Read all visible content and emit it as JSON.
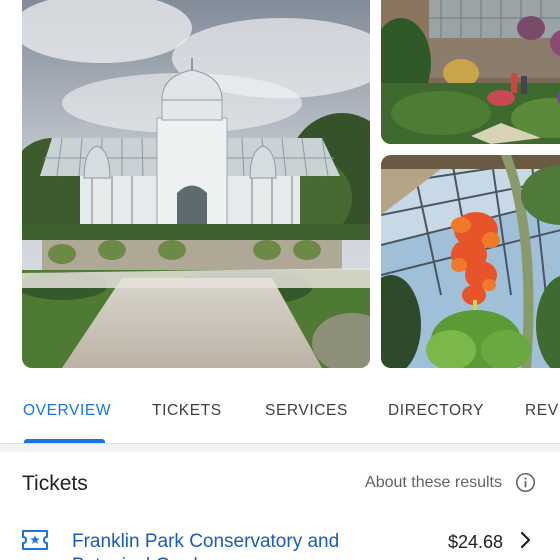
{
  "gallery": {
    "photos": [
      {
        "subject": "glass-conservatory-exterior"
      },
      {
        "subject": "garden-visitors"
      },
      {
        "subject": "glass-sculpture-interior"
      }
    ]
  },
  "tabs": [
    {
      "label": "OVERVIEW",
      "active": true
    },
    {
      "label": "TICKETS",
      "active": false
    },
    {
      "label": "SERVICES",
      "active": false
    },
    {
      "label": "DIRECTORY",
      "active": false
    },
    {
      "label": "REVI",
      "active": false
    }
  ],
  "tickets": {
    "title": "Tickets",
    "about_label": "About these results",
    "rows": [
      {
        "name": "Franklin Park Conservatory and Botanical Gardens",
        "price": "$24.68"
      }
    ]
  },
  "colors": {
    "accent": "#1a73e8",
    "link": "#1a5bbd",
    "divider": "#dadce0"
  },
  "icons": {
    "info": "info-icon",
    "ticket": "ticket-icon",
    "chevron": "chevron-right-icon"
  }
}
